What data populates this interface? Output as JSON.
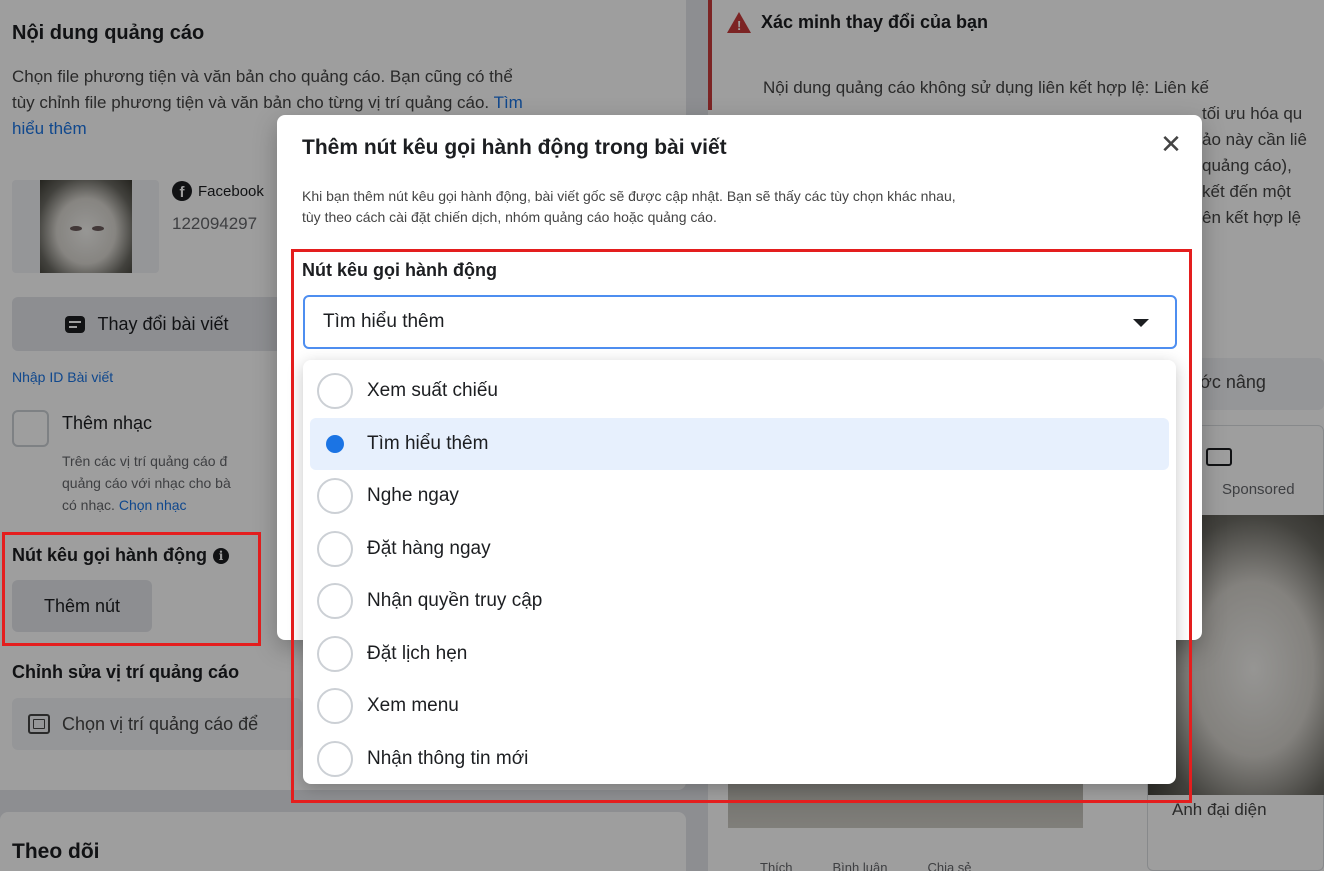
{
  "background": {
    "ad_content": {
      "title": "Nội dung quảng cáo",
      "description_line1": "Chọn file phương tiện và văn bản cho quảng cáo. Bạn cũng có thể",
      "description_line2": "tùy chỉnh file phương tiện và văn bản cho từng vị trí quảng cáo.",
      "learn_more_part1": "Tìm",
      "learn_more_part2": "hiểu thêm",
      "page_name": "Facebook",
      "post_id": "122094297",
      "change_post_button": "Thay đổi bài viết",
      "enter_post_id_link": "Nhập ID Bài viết",
      "add_music_label": "Thêm nhạc",
      "music_desc_line1": "Trên các vị trí quảng cáo đ",
      "music_desc_line2": "quảng cáo với nhạc cho bà",
      "music_desc_line3": "có nhạc.",
      "choose_music_link": "Chọn nhạc",
      "cta_label": "Nút kêu gọi hành động",
      "add_button": "Thêm nút",
      "edit_placement_label": "Chỉnh sửa vị trí quảng cáo",
      "choose_placement_input": "Chọn vị trí quảng cáo để",
      "follow_label": "Theo dõi"
    },
    "right_panel": {
      "warning_title": "Xác minh thay đổi của bạn",
      "warning_lines": [
        "Nội dung quảng cáo không sử dụng liên kết hợp lệ: Liên kế",
        "",
        "tối ưu hóa qu",
        "ảo này cần liê",
        "quảng cáo), ",
        "kết đến một",
        "ên kết hợp lệ"
      ],
      "preview_button": "n trước nâng",
      "sponsored": "Sponsored",
      "avatar_label": "Ảnh đại diện",
      "social": [
        "Thích",
        "Bình luận",
        "Chia sẻ"
      ]
    }
  },
  "modal": {
    "title": "Thêm nút kêu gọi hành động trong bài viết",
    "description_line1": "Khi bạn thêm nút kêu gọi hành động, bài viết gốc sẽ được cập nhật. Bạn sẽ thấy các tùy chọn khác nhau,",
    "description_line2": "tùy theo cách cài đặt chiến dịch, nhóm quảng cáo hoặc quảng cáo.",
    "field_label": "Nút kêu gọi hành động",
    "selected_value": "Tìm hiểu thêm",
    "options": [
      {
        "label": "Xem suất chiếu",
        "selected": false
      },
      {
        "label": "Tìm hiểu thêm",
        "selected": true
      },
      {
        "label": "Nghe ngay",
        "selected": false
      },
      {
        "label": "Đặt hàng ngay",
        "selected": false
      },
      {
        "label": "Nhận quyền truy cập",
        "selected": false
      },
      {
        "label": "Đặt lịch hẹn",
        "selected": false
      },
      {
        "label": "Xem menu",
        "selected": false
      },
      {
        "label": "Nhận thông tin mới",
        "selected": false
      }
    ]
  },
  "colors": {
    "accent": "#1b74e4",
    "highlight_border": "#e41e1e",
    "warning": "#c83a3a",
    "selected_option_bg": "#e7f0fd"
  }
}
